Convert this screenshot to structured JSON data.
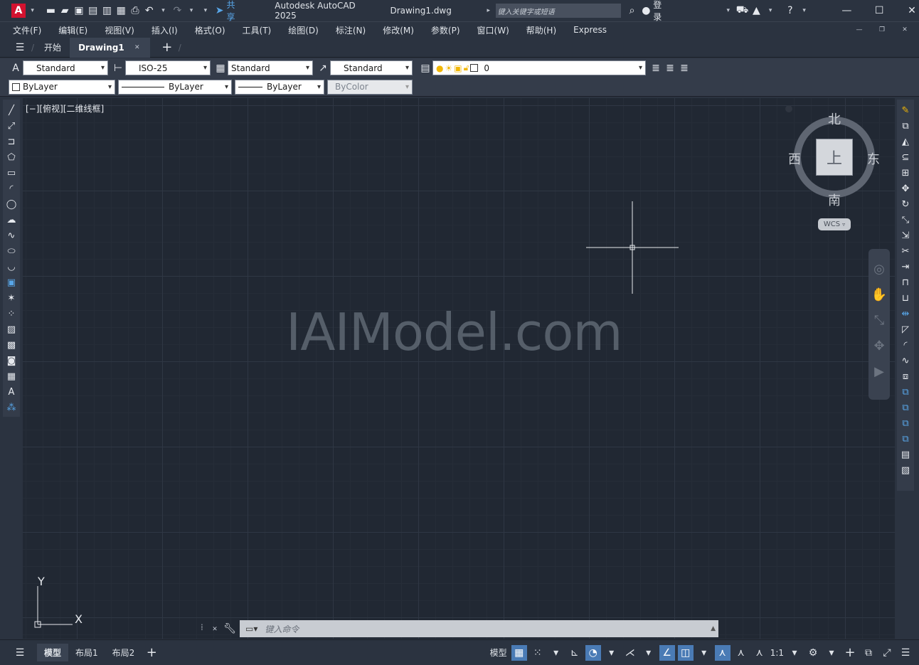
{
  "app_title": "Autodesk AutoCAD 2025",
  "file_name": "Drawing1.dwg",
  "share_label": "共享",
  "search_placeholder": "键入关键字或短语",
  "signin_label": "登录",
  "menus": [
    "文件(F)",
    "编辑(E)",
    "视图(V)",
    "插入(I)",
    "格式(O)",
    "工具(T)",
    "绘图(D)",
    "标注(N)",
    "修改(M)",
    "参数(P)",
    "窗口(W)",
    "帮助(H)",
    "Express"
  ],
  "tabs": {
    "start": "开始",
    "doc": "Drawing1"
  },
  "toolbar1": {
    "text_style": "Standard",
    "dim_style": "ISO-25",
    "table_style": "Standard",
    "mleader_style": "Standard",
    "layer": "0"
  },
  "toolbar2": {
    "color": "ByLayer",
    "linetype": "ByLayer",
    "lineweight": "ByLayer",
    "plotstyle": "ByColor"
  },
  "viewport_label": "[−][俯视][二维线框]",
  "viewcube": {
    "north": "北",
    "south": "南",
    "east": "东",
    "west": "西",
    "top": "上",
    "wcs": "WCS"
  },
  "ucs": {
    "x": "X",
    "y": "Y"
  },
  "watermark": "IAIModel.com",
  "command_placeholder": "键入命令",
  "layout_tabs": [
    "模型",
    "布局1",
    "布局2"
  ],
  "status": {
    "model": "模型",
    "scale": "1:1"
  }
}
